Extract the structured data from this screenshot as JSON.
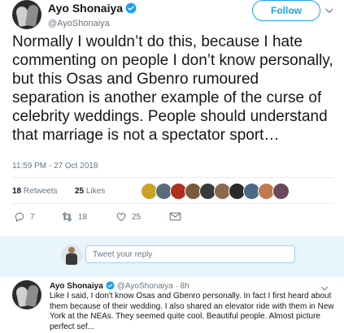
{
  "author": {
    "name": "Ayo Shonaiya",
    "handle": "@AyoShonaiya",
    "follow_label": "Follow"
  },
  "tweet": {
    "text": "Normally I wouldn’t do this, because I hate commenting on people I don’t know personally, but this Osas and Gbenro rumoured separation is another example of the curse of celebrity weddings. People should understand that marriage is not a spectator sport…",
    "timestamp": "11:59 PM - 27 Oct 2018",
    "retweets_count": "18",
    "retweets_label": "Retweets",
    "likes_count": "25",
    "likes_label": "Likes"
  },
  "actions": {
    "reply_count": "7",
    "retweet_count": "18",
    "like_count": "25"
  },
  "likers": [
    "#c9a227",
    "#5a6b7a",
    "#b03020",
    "#7a5a3a",
    "#3a3a3a",
    "#8a6a4a",
    "#2a2a2a",
    "#4a6a8a",
    "#c07a50",
    "#6a4a5a"
  ],
  "reply_box": {
    "placeholder": "Tweet your reply"
  },
  "reply": {
    "name": "Ayo Shonaiya",
    "handle_time": "@AyoShonaiya · 8h",
    "text": "Like I said, I don't know Osas and Gbenro personally. In fact I first heard about them because of their wedding. I also shared an elevator ride with them in New York at the NEAs. They seemed quite cool. Beautiful people. Almost picture perfect sef..."
  },
  "colors": {
    "accent": "#1da1f2",
    "muted": "#657786",
    "reply_bg": "#e8f5fd"
  }
}
